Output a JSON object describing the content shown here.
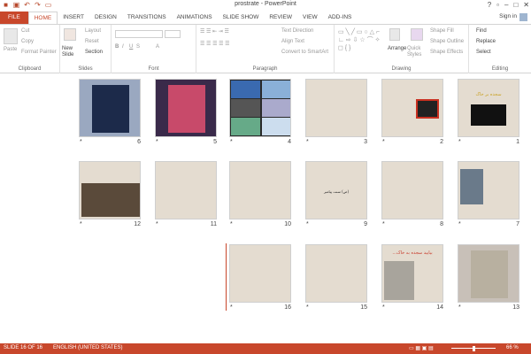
{
  "window": {
    "title": "prostrate - PowerPoint",
    "signin": "Sign in"
  },
  "tabs": [
    "FILE",
    "HOME",
    "INSERT",
    "DESIGN",
    "TRANSITIONS",
    "ANIMATIONS",
    "SLIDE SHOW",
    "REVIEW",
    "VIEW",
    "ADD-INS"
  ],
  "ribbon": {
    "clipboard": {
      "label": "Clipboard",
      "paste": "Paste",
      "cut": "Cut",
      "copy": "Copy",
      "format_painter": "Format Painter"
    },
    "slides": {
      "label": "Slides",
      "new_slide": "New Slide",
      "layout": "Layout",
      "reset": "Reset",
      "section": "Section"
    },
    "font": {
      "label": "Font"
    },
    "paragraph": {
      "label": "Paragraph",
      "text_direction": "Text Direction",
      "align_text": "Align Text",
      "convert": "Convert to SmartArt"
    },
    "drawing": {
      "label": "Drawing",
      "arrange": "Arrange",
      "quick_styles": "Quick Styles",
      "shape_fill": "Shape Fill",
      "shape_outline": "Shape Outline",
      "shape_effects": "Shape Effects"
    },
    "editing": {
      "label": "Editing",
      "find": "Find",
      "replace": "Replace",
      "select": "Select"
    }
  },
  "slides": [
    {
      "num": "1",
      "star": "*",
      "theme": "dark-title",
      "text": "سجده بر خاک"
    },
    {
      "num": "2",
      "star": "*",
      "theme": "warning",
      "text": ""
    },
    {
      "num": "3",
      "star": "*",
      "theme": "beige",
      "text": ""
    },
    {
      "num": "4",
      "star": "*",
      "theme": "photos",
      "text": ""
    },
    {
      "num": "5",
      "star": "*",
      "theme": "city",
      "text": ""
    },
    {
      "num": "6",
      "star": "*",
      "theme": "person",
      "text": ""
    },
    {
      "num": "7",
      "star": "*",
      "theme": "computer",
      "text": ""
    },
    {
      "num": "8",
      "star": "*",
      "theme": "beige",
      "text": ""
    },
    {
      "num": "9",
      "star": "*",
      "theme": "beige",
      "text": "(ص) سنت پیامبر"
    },
    {
      "num": "10",
      "star": "*",
      "theme": "redtext",
      "text": ""
    },
    {
      "num": "11",
      "star": "*",
      "theme": "beige-text",
      "text": ""
    },
    {
      "num": "12",
      "star": "*",
      "theme": "mecca",
      "text": ""
    },
    {
      "num": "13",
      "star": "*",
      "theme": "map",
      "text": ""
    },
    {
      "num": "14",
      "star": "*",
      "theme": "prayer",
      "text": "بیایید سجده به خاک..."
    },
    {
      "num": "15",
      "star": "*",
      "theme": "beige-text",
      "text": ""
    },
    {
      "num": "16",
      "star": "*",
      "theme": "beige-text",
      "text": ""
    }
  ],
  "status": {
    "slide": "SLIDE 16 OF 16",
    "language": "ENGLISH (UNITED STATES)",
    "zoom": "66 %"
  },
  "colors": {
    "accent": "#c8472b",
    "slide_bg": "#e4dcd0"
  }
}
